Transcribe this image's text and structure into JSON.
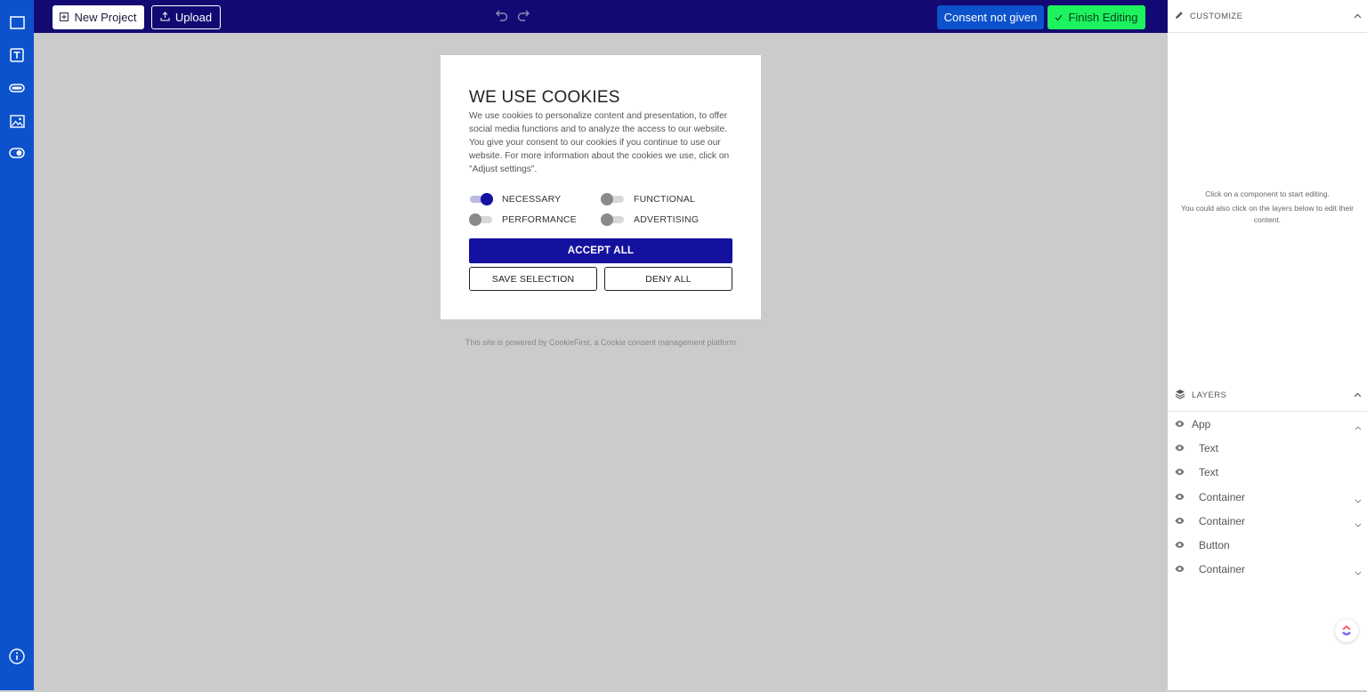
{
  "toolbar": {
    "new_project": "New Project",
    "upload": "Upload",
    "consent_status": "Consent not given",
    "finish_editing": "Finish Editing"
  },
  "banner": {
    "title": "WE USE COOKIES",
    "body": "We use cookies to personalize content and presentation, to offer social media functions and to analyze the access to our website. You give your consent to our cookies if you continue to use our website. For more information about the cookies we use, click on \"Adjust settings\".",
    "toggles": [
      {
        "label": "NECESSARY",
        "on": true
      },
      {
        "label": "FUNCTIONAL",
        "on": false
      },
      {
        "label": "PERFORMANCE",
        "on": false
      },
      {
        "label": "ADVERTISING",
        "on": false
      }
    ],
    "accept_all": "ACCEPT ALL",
    "save_selection": "SAVE SELECTION",
    "deny_all": "DENY ALL",
    "powered_by": "This site is powered by CookieFirst, a Cookie consent management platform"
  },
  "customize": {
    "heading": "CUSTOMIZE",
    "hint_line1": "Click on a component to start editing.",
    "hint_line2": "You could also click on the layers below to edit their content."
  },
  "layers": {
    "heading": "LAYERS",
    "items": [
      {
        "label": "App",
        "chevron": "chevron-up-icon"
      },
      {
        "label": "Text",
        "chevron": ""
      },
      {
        "label": "Text",
        "chevron": ""
      },
      {
        "label": "Container",
        "chevron": "chevron-down-icon"
      },
      {
        "label": "Container",
        "chevron": "chevron-down-icon"
      },
      {
        "label": "Button",
        "chevron": ""
      },
      {
        "label": "Container",
        "chevron": "chevron-down-icon"
      }
    ]
  },
  "colors": {
    "rail": "#0b52cc",
    "topbar": "#120a72",
    "accent": "#15119f",
    "finish": "#1cf35f",
    "canvas": "#cbcbcb"
  },
  "icons": {
    "rail": [
      "container-icon",
      "text-icon",
      "button-icon",
      "image-icon",
      "toggle-icon",
      "info-icon"
    ]
  }
}
